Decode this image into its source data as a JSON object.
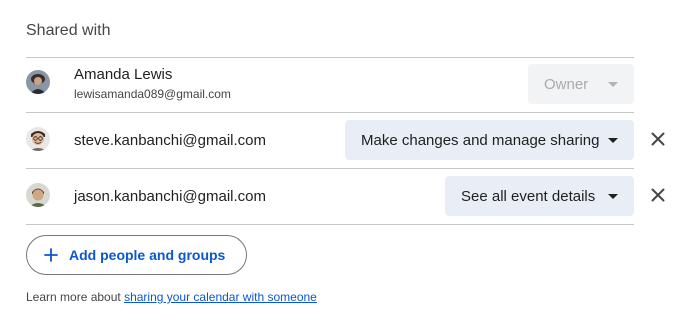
{
  "section": {
    "title": "Shared with"
  },
  "people": [
    {
      "name": "Amanda Lewis",
      "email": "lewisamanda089@gmail.com",
      "permission": "Owner",
      "permission_enabled": false,
      "removable": false,
      "avatar_icon": "user-avatar-icon"
    },
    {
      "name": "steve.kanbanchi@gmail.com",
      "permission": "Make changes and manage sharing",
      "permission_enabled": true,
      "removable": true,
      "avatar_icon": "user-avatar-icon"
    },
    {
      "name": "jason.kanbanchi@gmail.com",
      "permission": "See all event details",
      "permission_enabled": true,
      "removable": true,
      "avatar_icon": "user-avatar-icon"
    }
  ],
  "add_button": {
    "label": "Add people and groups",
    "icon": "plus-icon"
  },
  "footer": {
    "text": "Learn more about ",
    "link_text": "sharing your calendar with someone"
  },
  "colors": {
    "accent": "#0b57d0",
    "chip_bg": "#e9eef6",
    "disabled_bg": "#f1f3f4",
    "divider": "#c4c7c5"
  }
}
